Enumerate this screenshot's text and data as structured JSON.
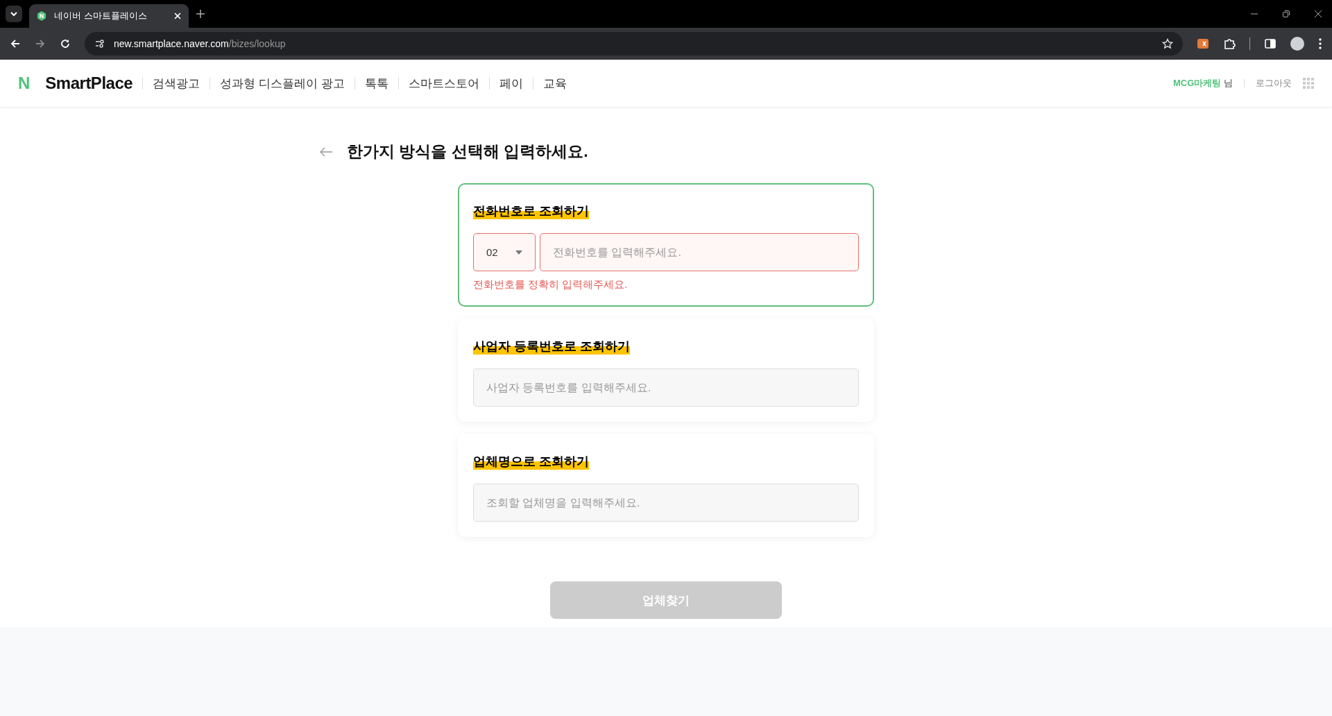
{
  "browser": {
    "tab_title": "네이버 스마트플레이스",
    "url_host": "new.smartplace.naver.com",
    "url_path": "/bizes/lookup"
  },
  "header": {
    "logo_mark": "N",
    "logo": "SmartPlace",
    "nav": [
      "검색광고",
      "성과형 디스플레이 광고",
      "톡톡",
      "스마트스토어",
      "페이",
      "교육"
    ],
    "user_name": "MCG마케팅",
    "user_suffix": "님",
    "logout": "로그아웃"
  },
  "page_title": "한가지 방식을 선택해 입력하세요.",
  "methods": [
    {
      "kind": "phone",
      "title": "전화번호로 조회하기",
      "selected": true,
      "area_code": "02",
      "placeholder": "전화번호를 입력해주세요.",
      "error": "전화번호를 정확히 입력해주세요."
    },
    {
      "kind": "text",
      "title": "사업자 등록번호로 조회하기",
      "selected": false,
      "placeholder": "사업자 등록번호를 입력해주세요."
    },
    {
      "kind": "text",
      "title": "업체명으로 조회하기",
      "selected": false,
      "placeholder": "조회할 업체명을 입력해주세요."
    }
  ],
  "submit": {
    "label": "업체찾기",
    "disabled": true
  }
}
